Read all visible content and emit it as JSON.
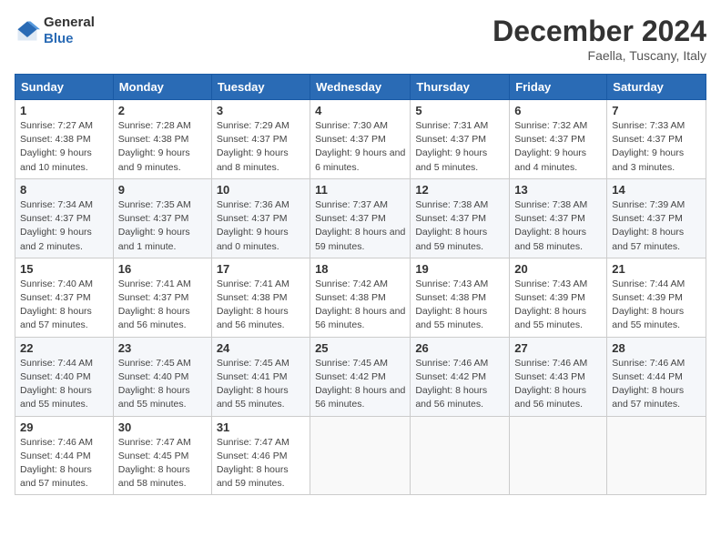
{
  "header": {
    "logo": {
      "general": "General",
      "blue": "Blue"
    },
    "title": "December 2024",
    "subtitle": "Faella, Tuscany, Italy"
  },
  "calendar": {
    "weekdays": [
      "Sunday",
      "Monday",
      "Tuesday",
      "Wednesday",
      "Thursday",
      "Friday",
      "Saturday"
    ],
    "weeks": [
      [
        {
          "day": "1",
          "sunrise": "7:27 AM",
          "sunset": "4:38 PM",
          "daylight": "9 hours and 10 minutes."
        },
        {
          "day": "2",
          "sunrise": "7:28 AM",
          "sunset": "4:38 PM",
          "daylight": "9 hours and 9 minutes."
        },
        {
          "day": "3",
          "sunrise": "7:29 AM",
          "sunset": "4:37 PM",
          "daylight": "9 hours and 8 minutes."
        },
        {
          "day": "4",
          "sunrise": "7:30 AM",
          "sunset": "4:37 PM",
          "daylight": "9 hours and 6 minutes."
        },
        {
          "day": "5",
          "sunrise": "7:31 AM",
          "sunset": "4:37 PM",
          "daylight": "9 hours and 5 minutes."
        },
        {
          "day": "6",
          "sunrise": "7:32 AM",
          "sunset": "4:37 PM",
          "daylight": "9 hours and 4 minutes."
        },
        {
          "day": "7",
          "sunrise": "7:33 AM",
          "sunset": "4:37 PM",
          "daylight": "9 hours and 3 minutes."
        }
      ],
      [
        {
          "day": "8",
          "sunrise": "7:34 AM",
          "sunset": "4:37 PM",
          "daylight": "9 hours and 2 minutes."
        },
        {
          "day": "9",
          "sunrise": "7:35 AM",
          "sunset": "4:37 PM",
          "daylight": "9 hours and 1 minute."
        },
        {
          "day": "10",
          "sunrise": "7:36 AM",
          "sunset": "4:37 PM",
          "daylight": "9 hours and 0 minutes."
        },
        {
          "day": "11",
          "sunrise": "7:37 AM",
          "sunset": "4:37 PM",
          "daylight": "8 hours and 59 minutes."
        },
        {
          "day": "12",
          "sunrise": "7:38 AM",
          "sunset": "4:37 PM",
          "daylight": "8 hours and 59 minutes."
        },
        {
          "day": "13",
          "sunrise": "7:38 AM",
          "sunset": "4:37 PM",
          "daylight": "8 hours and 58 minutes."
        },
        {
          "day": "14",
          "sunrise": "7:39 AM",
          "sunset": "4:37 PM",
          "daylight": "8 hours and 57 minutes."
        }
      ],
      [
        {
          "day": "15",
          "sunrise": "7:40 AM",
          "sunset": "4:37 PM",
          "daylight": "8 hours and 57 minutes."
        },
        {
          "day": "16",
          "sunrise": "7:41 AM",
          "sunset": "4:37 PM",
          "daylight": "8 hours and 56 minutes."
        },
        {
          "day": "17",
          "sunrise": "7:41 AM",
          "sunset": "4:38 PM",
          "daylight": "8 hours and 56 minutes."
        },
        {
          "day": "18",
          "sunrise": "7:42 AM",
          "sunset": "4:38 PM",
          "daylight": "8 hours and 56 minutes."
        },
        {
          "day": "19",
          "sunrise": "7:43 AM",
          "sunset": "4:38 PM",
          "daylight": "8 hours and 55 minutes."
        },
        {
          "day": "20",
          "sunrise": "7:43 AM",
          "sunset": "4:39 PM",
          "daylight": "8 hours and 55 minutes."
        },
        {
          "day": "21",
          "sunrise": "7:44 AM",
          "sunset": "4:39 PM",
          "daylight": "8 hours and 55 minutes."
        }
      ],
      [
        {
          "day": "22",
          "sunrise": "7:44 AM",
          "sunset": "4:40 PM",
          "daylight": "8 hours and 55 minutes."
        },
        {
          "day": "23",
          "sunrise": "7:45 AM",
          "sunset": "4:40 PM",
          "daylight": "8 hours and 55 minutes."
        },
        {
          "day": "24",
          "sunrise": "7:45 AM",
          "sunset": "4:41 PM",
          "daylight": "8 hours and 55 minutes."
        },
        {
          "day": "25",
          "sunrise": "7:45 AM",
          "sunset": "4:42 PM",
          "daylight": "8 hours and 56 minutes."
        },
        {
          "day": "26",
          "sunrise": "7:46 AM",
          "sunset": "4:42 PM",
          "daylight": "8 hours and 56 minutes."
        },
        {
          "day": "27",
          "sunrise": "7:46 AM",
          "sunset": "4:43 PM",
          "daylight": "8 hours and 56 minutes."
        },
        {
          "day": "28",
          "sunrise": "7:46 AM",
          "sunset": "4:44 PM",
          "daylight": "8 hours and 57 minutes."
        }
      ],
      [
        {
          "day": "29",
          "sunrise": "7:46 AM",
          "sunset": "4:44 PM",
          "daylight": "8 hours and 57 minutes."
        },
        {
          "day": "30",
          "sunrise": "7:47 AM",
          "sunset": "4:45 PM",
          "daylight": "8 hours and 58 minutes."
        },
        {
          "day": "31",
          "sunrise": "7:47 AM",
          "sunset": "4:46 PM",
          "daylight": "8 hours and 59 minutes."
        },
        null,
        null,
        null,
        null
      ]
    ]
  }
}
